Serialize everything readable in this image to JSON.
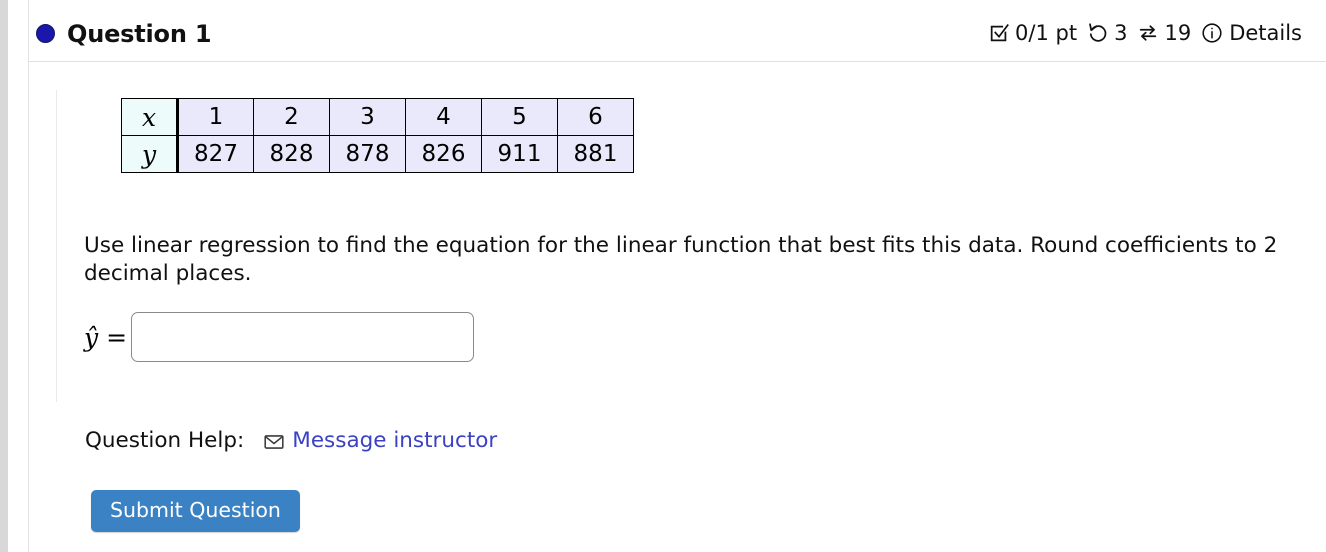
{
  "header": {
    "title": "Question 1",
    "status_dot_color": "#1a18a8",
    "score": "0/1 pt",
    "attempts": "3",
    "versions": "19",
    "details_label": "Details",
    "icons": {
      "score": "checkbox-check-icon",
      "attempts": "undo-arrow-icon",
      "versions": "swap-arrows-icon",
      "details": "info-circle-icon"
    }
  },
  "table": {
    "row_labels": [
      "x",
      "y"
    ],
    "x_values": [
      "1",
      "2",
      "3",
      "4",
      "5",
      "6"
    ],
    "y_values": [
      "827",
      "828",
      "878",
      "826",
      "911",
      "881"
    ],
    "label_cell_color": "#edfcfb",
    "data_cell_color": "#eae9fb"
  },
  "prompt": "Use linear regression to find the equation for the linear function that best fits this data. Round coefficients to 2 decimal places.",
  "answer": {
    "label": "ŷ =",
    "value": "",
    "placeholder": ""
  },
  "help": {
    "label": "Question Help:",
    "link_text": "Message instructor",
    "link_color": "#3b41c4",
    "icon": "envelope-icon"
  },
  "submit": {
    "label": "Submit Question",
    "color": "#3b82c4"
  },
  "chart_data": {
    "type": "table",
    "title": "",
    "categories": [
      "1",
      "2",
      "3",
      "4",
      "5",
      "6"
    ],
    "series": [
      {
        "name": "y",
        "values": [
          827,
          828,
          878,
          826,
          911,
          881
        ]
      }
    ],
    "xlabel": "x",
    "ylabel": "y"
  }
}
